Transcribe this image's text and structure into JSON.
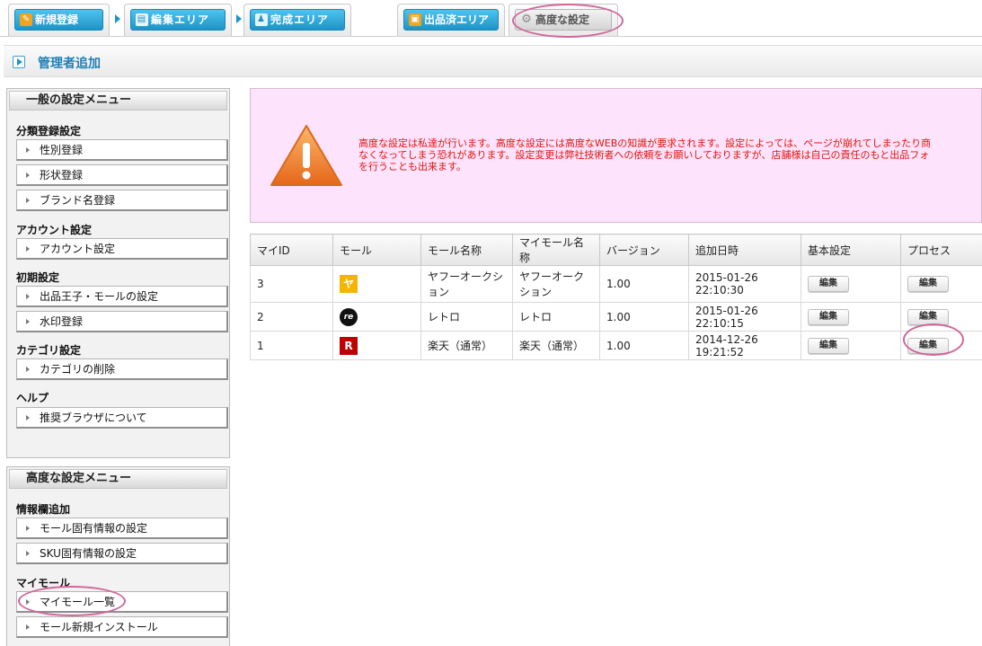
{
  "tabs": [
    {
      "label": "新規登録",
      "icon": "edit-icon",
      "style": "blue"
    },
    {
      "label": "編集エリア",
      "icon": "list-icon",
      "style": "blue"
    },
    {
      "label": "完成エリア",
      "icon": "people-icon",
      "style": "blue"
    },
    {
      "label": "出品済エリア",
      "icon": "box-icon",
      "style": "blue"
    },
    {
      "label": "高度な設定",
      "icon": "gear-icon",
      "style": "gray",
      "active": true
    }
  ],
  "page": {
    "title": "管理者追加"
  },
  "sidebar": {
    "general": {
      "title": "一般の設定メニュー",
      "sections": [
        {
          "label": "分類登録設定",
          "items": [
            "性別登録",
            "形状登録",
            "ブランド名登録"
          ]
        },
        {
          "label": "アカウント設定",
          "items": [
            "アカウント設定"
          ]
        },
        {
          "label": "初期設定",
          "items": [
            "出品王子・モールの設定",
            "水印登録"
          ]
        },
        {
          "label": "カテゴリ設定",
          "items": [
            "カテゴリの削除"
          ]
        },
        {
          "label": "ヘルプ",
          "items": [
            "推奨ブラウザについて"
          ]
        }
      ]
    },
    "advanced": {
      "title": "高度な設定メニュー",
      "sections": [
        {
          "label": "情報欄追加",
          "items": [
            "モール固有情報の設定",
            "SKU固有情報の設定"
          ]
        },
        {
          "label": "マイモール",
          "items": [
            "マイモール一覧",
            "モール新規インストール"
          ]
        }
      ]
    }
  },
  "warning": {
    "icon": "warning-triangle-icon",
    "lines": [
      "高度な設定は私達が行います。高度な設定には高度なWEBの知識が要求されます。設定によっては、ページが崩れてしまったり商",
      "なくなってしまう恐れがあります。設定変更は弊社技術者への依頼をお願いしておりますが、店舗様は自己の責任のもと出品フォ",
      "を行うことも出来ます。"
    ]
  },
  "table": {
    "headers": [
      "マイID",
      "モール",
      "モール名称",
      "マイモール名称",
      "バージョン",
      "追加日時",
      "基本設定",
      "プロセス"
    ],
    "rows": [
      {
        "id": "3",
        "mall_icon": "ヤ",
        "mall_color": "#f5b400",
        "mall_name": "ヤフーオークション",
        "my_mall_name": "ヤフーオークション",
        "version": "1.00",
        "added": "2015-01-26 22:10:30",
        "basic": "編集",
        "process": "編集"
      },
      {
        "id": "2",
        "mall_icon": "re",
        "mall_color": "#111111",
        "mall_name": "レトロ",
        "my_mall_name": "レトロ",
        "version": "1.00",
        "added": "2015-01-26 22:10:15",
        "basic": "編集",
        "process": "編集"
      },
      {
        "id": "1",
        "mall_icon": "R",
        "mall_color": "#bf0000",
        "mall_name": "楽天（通常）",
        "my_mall_name": "楽天（通常）",
        "version": "1.00",
        "added": "2014-12-26 19:21:52",
        "basic": "編集",
        "process": "編集"
      }
    ]
  },
  "colors": {
    "accent": "#1d93c7",
    "warning_bg": "#fde3fb",
    "warning_text": "#e4140d",
    "annotation": "#d0669a"
  }
}
